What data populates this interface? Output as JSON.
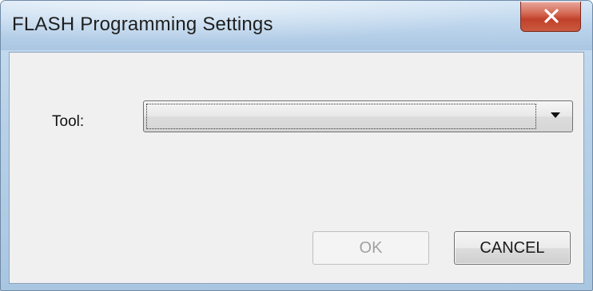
{
  "window": {
    "title": "FLASH Programming Settings"
  },
  "form": {
    "tool_label": "Tool:",
    "tool_value": ""
  },
  "buttons": {
    "ok_label": "OK",
    "cancel_label": "CANCEL",
    "ok_enabled": false
  },
  "icons": {
    "close": "close-icon",
    "dropdown": "chevron-down-icon"
  },
  "colors": {
    "close_button": "#c9452d",
    "title_bar": "#bdd5ec",
    "dialog_background": "#f0f0f0"
  }
}
